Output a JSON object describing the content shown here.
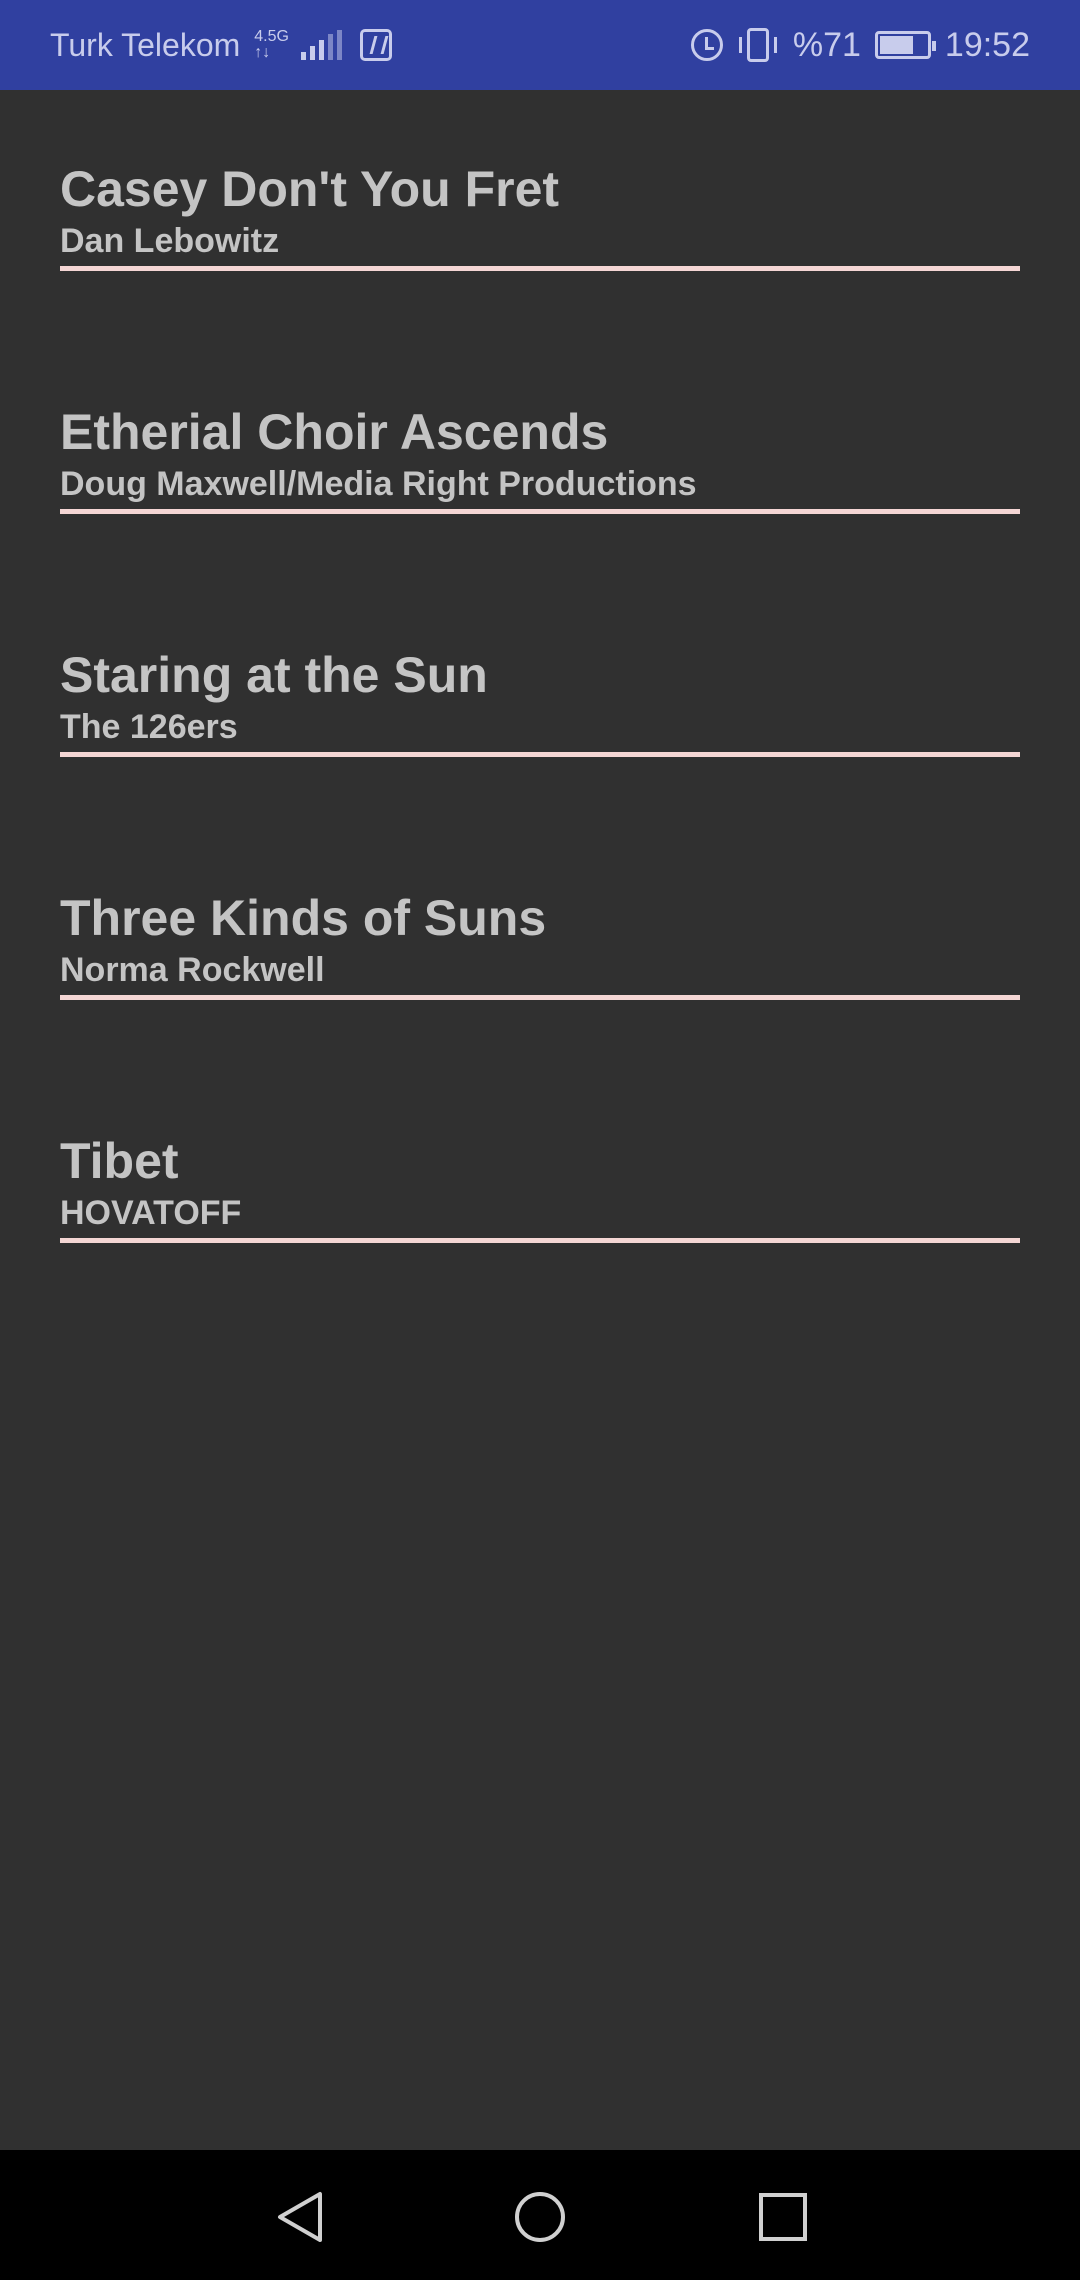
{
  "status_bar": {
    "carrier": "Turk Telekom",
    "network_top": "4.5G",
    "network_bottom": "↑↓",
    "battery_percent": "%71",
    "battery_level": 0.71,
    "time": "19:52",
    "icons": [
      "signal-icon",
      "nfc-icon",
      "alarm-icon",
      "vibrate-icon",
      "battery-charging-icon"
    ]
  },
  "songs": [
    {
      "title": "Casey Don't You Fret",
      "artist": "Dan Lebowitz"
    },
    {
      "title": "Etherial Choir Ascends",
      "artist": "Doug Maxwell/Media Right Productions"
    },
    {
      "title": "Staring at the Sun",
      "artist": "The 126ers"
    },
    {
      "title": "Three Kinds of Suns",
      "artist": "Norma Rockwell"
    },
    {
      "title": "Tibet",
      "artist": "HOVATOFF"
    }
  ],
  "nav_bar": {
    "icons": [
      "back-icon",
      "home-icon",
      "recent-apps-icon"
    ]
  },
  "colors": {
    "status_bar": "#3040a0",
    "background": "#303030",
    "text": "#c4c4c4",
    "divider": "#f4d6d4",
    "nav_bar": "#000000"
  }
}
